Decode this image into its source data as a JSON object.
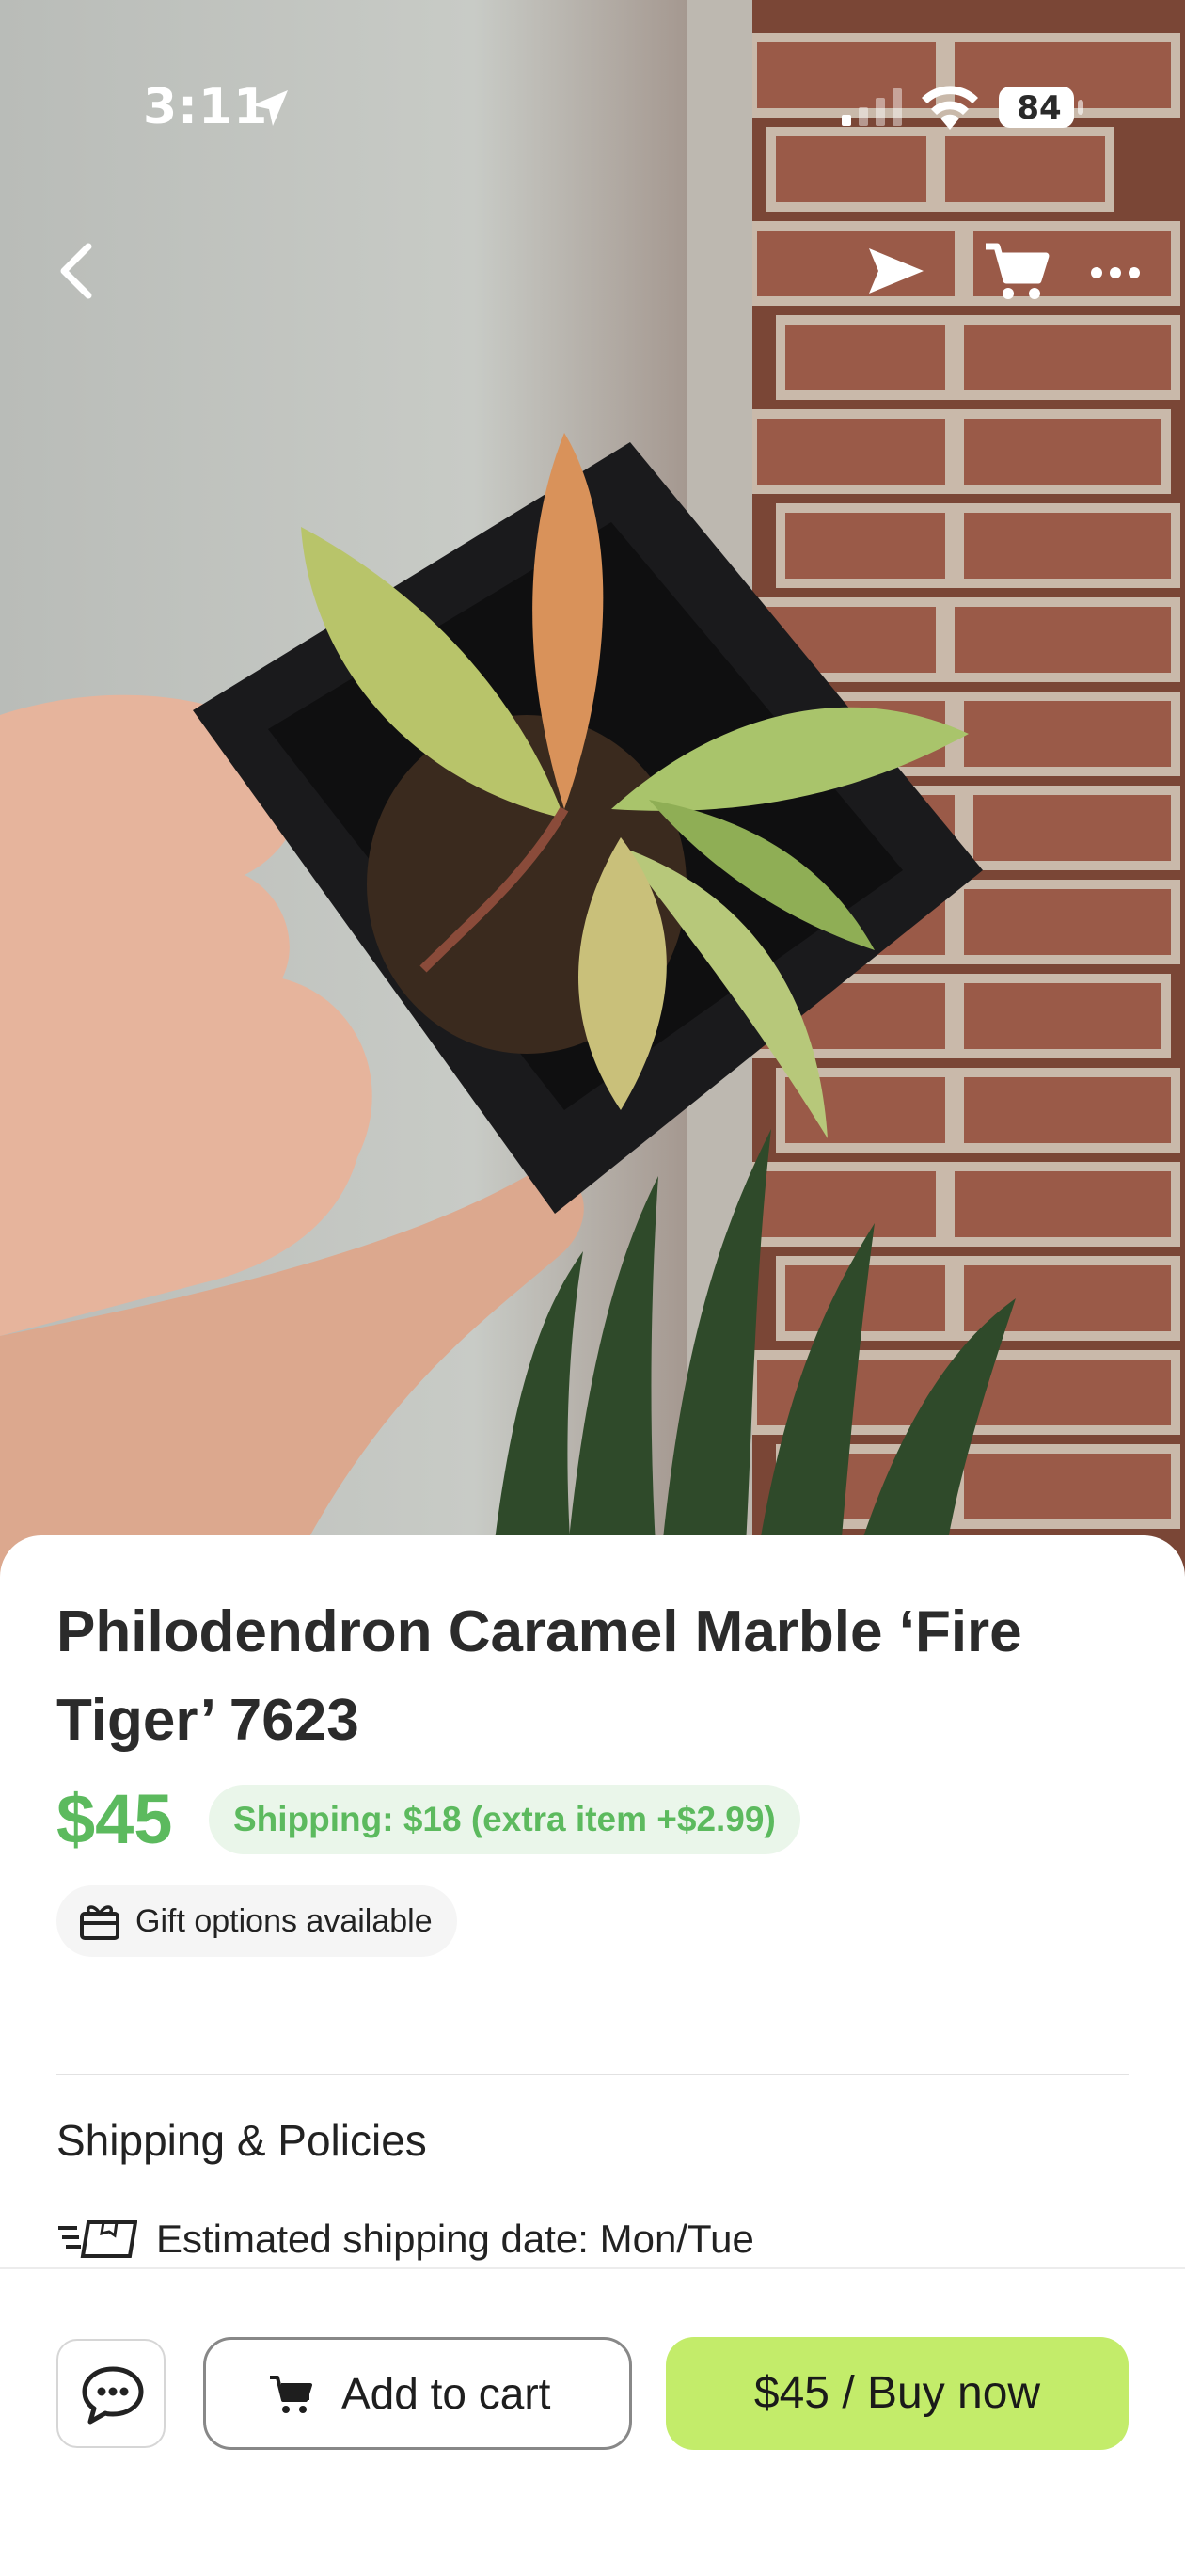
{
  "status_bar": {
    "time": "3:11",
    "battery": "84"
  },
  "hero": {
    "image_icon": "plant-photo"
  },
  "product": {
    "title": "Philodendron Caramel Marble ‘Fire Tiger’ 7623",
    "price": "$45",
    "shipping": "Shipping: $18 (extra item +$2.99)",
    "gift_options": "Gift options available"
  },
  "policies": {
    "section_title": "Shipping & Policies",
    "estimated_shipping": "Estimated shipping date: Mon/Tue"
  },
  "actions": {
    "add_to_cart": "Add to cart",
    "buy_now": "$45 / Buy now"
  },
  "colors": {
    "price_green": "#5cba5e",
    "buy_button": "#c3ec6a",
    "shipping_pill": "#eaf6ea"
  }
}
